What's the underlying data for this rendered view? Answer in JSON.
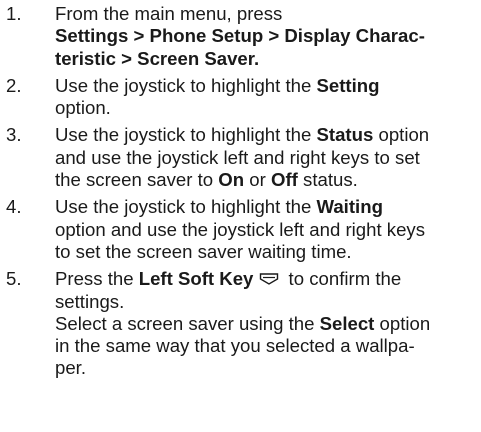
{
  "steps": [
    {
      "num": "1.",
      "l1": "From the main menu, press",
      "l2": "Settings > Phone Setup > Display Charac-",
      "l3": "teristic > Screen Saver."
    },
    {
      "num": "2.",
      "l1a": "Use the joystick to highlight the ",
      "l1b": "Setting",
      "l2": "option."
    },
    {
      "num": "3.",
      "l1a": "Use the joystick to highlight the ",
      "l1b": "Status",
      "l1c": " option",
      "l2": "and use the joystick left and right keys to set",
      "l3a": "the screen saver to ",
      "l3b": "On",
      "l3c": " or ",
      "l3d": "Off",
      "l3e": " status."
    },
    {
      "num": "4.",
      "l1a": "Use the joystick to highlight the ",
      "l1b": "Waiting",
      "l2": "option and use the joystick left and right keys",
      "l3": "to set the screen saver waiting time."
    },
    {
      "num": "5.",
      "l1a": "Press the ",
      "l1b": "Left Soft Key",
      "l1c": " to confirm the",
      "l2": "settings.",
      "l3a": "Select a screen saver using the ",
      "l3b": "Select",
      "l3c": " option",
      "l4": "in the same way that you selected a wallpa-",
      "l5": "per."
    }
  ],
  "icons": {
    "soft_key": "left-soft-key-icon"
  }
}
